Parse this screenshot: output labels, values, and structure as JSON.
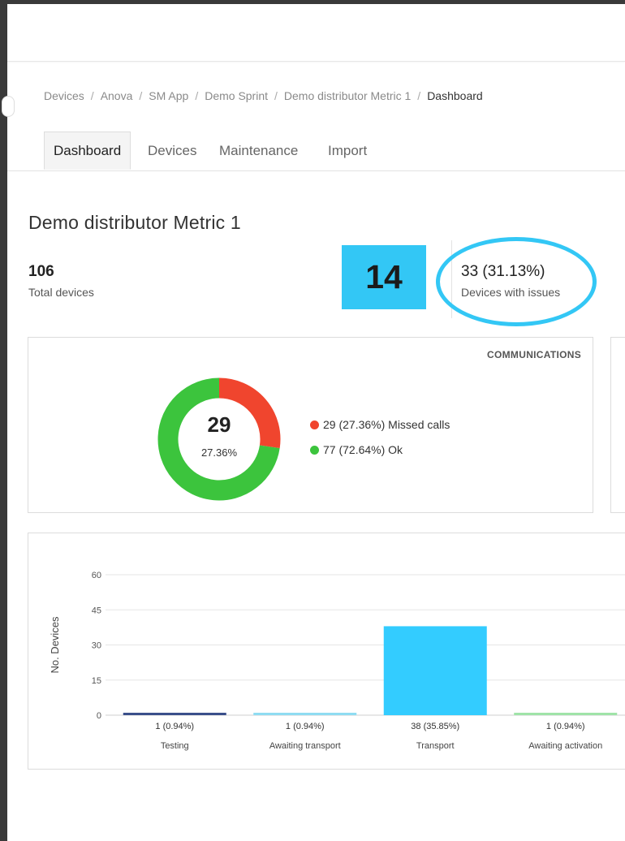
{
  "breadcrumb": {
    "items": [
      "Devices",
      "Anova",
      "SM App",
      "Demo Sprint",
      "Demo distributor Metric 1"
    ],
    "current": "Dashboard",
    "separator": "/"
  },
  "tabs": [
    {
      "label": "Dashboard",
      "active": true
    },
    {
      "label": "Devices",
      "active": false
    },
    {
      "label": "Maintenance",
      "active": false
    },
    {
      "label": "Import",
      "active": false
    }
  ],
  "page": {
    "title": "Demo distributor Metric 1"
  },
  "stats": {
    "total_devices": {
      "value": "106",
      "label": "Total devices"
    },
    "badge": {
      "value": "14",
      "color": "#33c7f5"
    },
    "devices_with_issues": {
      "value": "33 (31.13%)",
      "label": "Devices with issues"
    }
  },
  "communications": {
    "title": "COMMUNICATIONS",
    "center_value": "29",
    "center_percent": "27.36%",
    "legend": [
      {
        "label": "29 (27.36%) Missed calls",
        "color": "#f0452e"
      },
      {
        "label": "77 (72.64%) Ok",
        "color": "#3cc43d"
      }
    ]
  },
  "chart_data": {
    "type": "bar",
    "ylabel": "No. Devices",
    "ylim": [
      0,
      60
    ],
    "yticks": [
      "0",
      "15",
      "30",
      "45",
      "60"
    ],
    "categories": [
      "Testing",
      "Awaiting transport",
      "Transport",
      "Awaiting activation"
    ],
    "values": [
      1,
      1,
      38,
      1
    ],
    "value_labels": [
      "1 (0.94%)",
      "1 (0.94%)",
      "38 (35.85%)",
      "1 (0.94%)"
    ],
    "colors": [
      "#3a4f8a",
      "#8fdcf2",
      "#33ccff",
      "#9fe3a8"
    ],
    "donut": [
      {
        "name": "Missed calls",
        "value": 29,
        "color": "#f0452e"
      },
      {
        "name": "Ok",
        "value": 77,
        "color": "#3cc43d"
      }
    ]
  }
}
